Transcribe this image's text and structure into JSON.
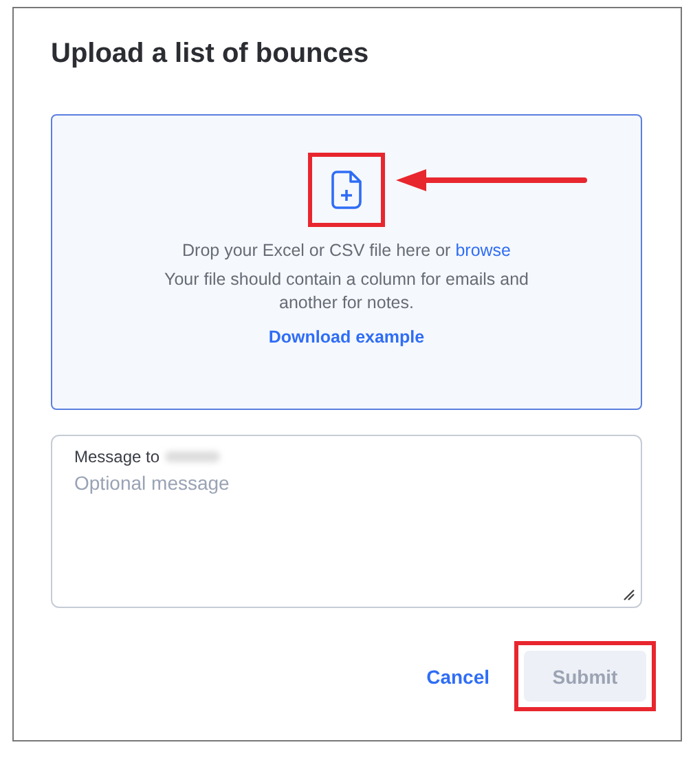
{
  "dialog": {
    "title": "Upload a list of bounces"
  },
  "dropzone": {
    "line_1": "Drop your Excel or CSV file here or",
    "browse_link": "browse",
    "line_2": "Your file should contain a column for emails and another for notes.",
    "download_link": "Download example"
  },
  "message": {
    "label": "Message to",
    "placeholder": "Optional message"
  },
  "buttons": [
    {
      "label": "Cancel",
      "kind": "link",
      "disabled": false
    },
    {
      "label": "Submit",
      "kind": "primary",
      "disabled": true
    }
  ]
}
